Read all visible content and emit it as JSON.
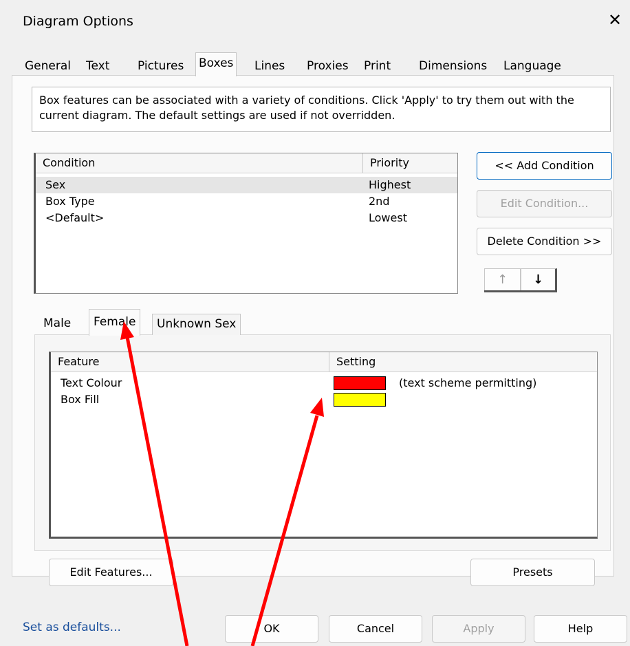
{
  "window": {
    "title": "Diagram Options",
    "close_glyph": "✕"
  },
  "tabs": [
    {
      "label": "General"
    },
    {
      "label": "Text"
    },
    {
      "label": "Pictures"
    },
    {
      "label": "Boxes"
    },
    {
      "label": "Lines"
    },
    {
      "label": "Proxies"
    },
    {
      "label": "Print"
    },
    {
      "label": "Dimensions"
    },
    {
      "label": "Language"
    }
  ],
  "active_tab": "Boxes",
  "info_text": "Box features can be associated with a variety of conditions.  Click 'Apply' to try them out with the current diagram.  The default settings are used if not overridden.",
  "conditions": {
    "headers": {
      "condition": "Condition",
      "priority": "Priority"
    },
    "rows": [
      {
        "condition": "Sex",
        "priority": "Highest",
        "selected": true
      },
      {
        "condition": "Box Type",
        "priority": "2nd",
        "selected": false
      },
      {
        "condition": "<Default>",
        "priority": "Lowest",
        "selected": false
      }
    ]
  },
  "condition_buttons": {
    "add": "<< Add Condition",
    "edit": "Edit Condition...",
    "delete": "Delete Condition >>",
    "up_glyph": "↑",
    "down_glyph": "↓"
  },
  "sex_tabs": [
    {
      "label": "Male"
    },
    {
      "label": "Female"
    },
    {
      "label": "Unknown Sex"
    }
  ],
  "active_sex_tab": "Female",
  "features": {
    "headers": {
      "feature": "Feature",
      "setting": "Setting"
    },
    "rows": [
      {
        "feature": "Text Colour",
        "color": "#ff0000",
        "note": "(text scheme permitting)"
      },
      {
        "feature": "Box Fill",
        "color": "#ffff00",
        "note": ""
      }
    ]
  },
  "panel_buttons": {
    "edit_features": "Edit Features...",
    "presets": "Presets"
  },
  "footer": {
    "set_defaults": "Set as defaults...",
    "ok": "OK",
    "cancel": "Cancel",
    "apply": "Apply",
    "help": "Help"
  },
  "annotation_color": "#ff0000"
}
